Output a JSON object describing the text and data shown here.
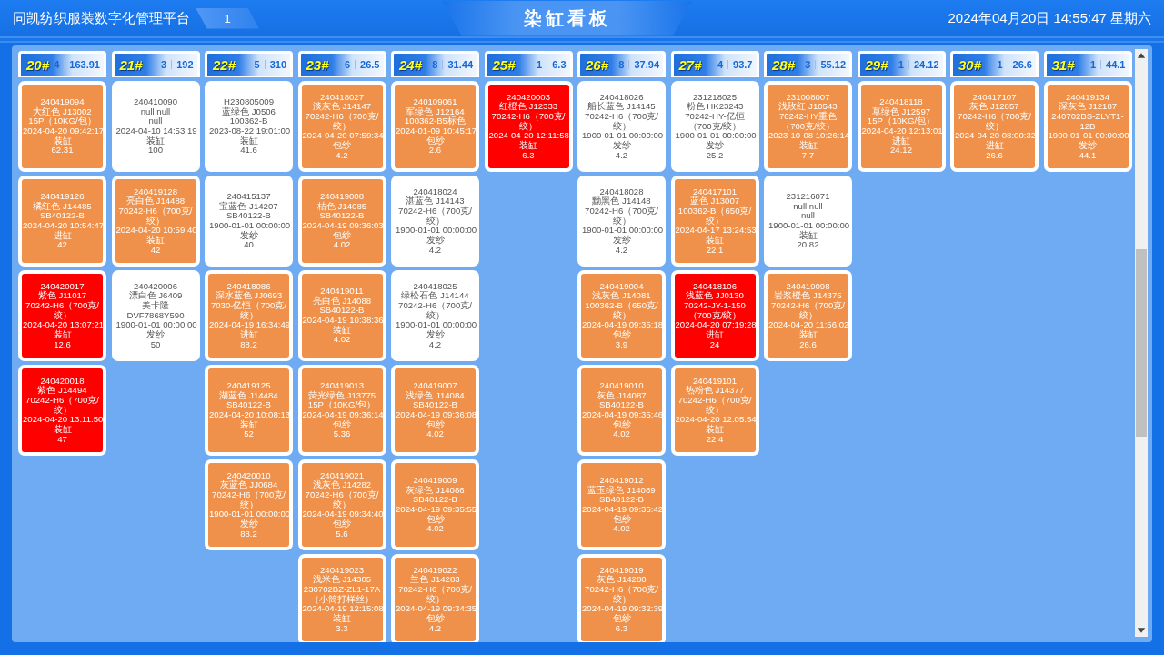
{
  "header": {
    "platform": "同凯纺织服装数字化管理平台",
    "tab": "1",
    "title": "染缸看板",
    "datetime": "2024年04月20日 14:55:47 星期六"
  },
  "columns": [
    {
      "tank": "20#",
      "count": "4",
      "weight": "163.91",
      "batches": [
        {
          "batch": "240419094",
          "shade": "大红色 J13002",
          "spec": "15P（10KG/包）",
          "time": "2024-04-20 09:42:17",
          "process": "装缸",
          "weight": "62.31",
          "loaded": true,
          "overdue": false
        },
        {
          "batch": "240419126",
          "shade": "橘红色 J14485",
          "spec": "SB40122-B",
          "time": "2024-04-20 10:54:47",
          "process": "进缸",
          "weight": "42",
          "loaded": true,
          "overdue": false
        },
        {
          "batch": "240420017",
          "shade": "紫色 J11017",
          "spec": "70242-H6（700克/绞）",
          "time": "2024-04-20 13:07:21",
          "process": "装缸",
          "weight": "12.6",
          "loaded": true,
          "overdue": true
        },
        {
          "batch": "240420018",
          "shade": "紫色 J14494",
          "spec": "70242-H6（700克/绞）",
          "time": "2024-04-20 13:11:50",
          "process": "装缸",
          "weight": "47",
          "loaded": true,
          "overdue": true
        }
      ]
    },
    {
      "tank": "21#",
      "count": "3",
      "weight": "192",
      "batches": [
        {
          "batch": "240410090",
          "shade": "null null",
          "spec": "null",
          "time": "2024-04-10 14:53:19",
          "process": "装缸",
          "weight": "100",
          "loaded": false,
          "overdue": false
        },
        {
          "batch": "240419128",
          "shade": "亮白色 J14488",
          "spec": "70242-H6（700克/绞）",
          "time": "2024-04-20 10:59:40",
          "process": "装缸",
          "weight": "42",
          "loaded": true,
          "overdue": false
        },
        {
          "batch": "240420006",
          "shade": "漂白色 J6409",
          "spec": "美卡隆DVF7868Y590",
          "time": "1900-01-01 00:00:00",
          "process": "发纱",
          "weight": "50",
          "loaded": false,
          "overdue": false
        }
      ]
    },
    {
      "tank": "22#",
      "count": "5",
      "weight": "310",
      "batches": [
        {
          "batch": "H230805009",
          "shade": "蓝绿色 J0506",
          "spec": "100362-B",
          "time": "2023-08-22 19:01:00",
          "process": "装缸",
          "weight": "41.6",
          "loaded": false,
          "overdue": false
        },
        {
          "batch": "240415137",
          "shade": "宝蓝色 J14207",
          "spec": "SB40122-B",
          "time": "1900-01-01 00:00:00",
          "process": "发纱",
          "weight": "40",
          "loaded": false,
          "overdue": false
        },
        {
          "batch": "240418086",
          "shade": "深水蓝色 JJ0693",
          "spec": "7030-亿恒（700克/绞）",
          "time": "2024-04-19 16:34:49",
          "process": "进缸",
          "weight": "88.2",
          "loaded": true,
          "overdue": false
        },
        {
          "batch": "240419125",
          "shade": "湖蓝色 J14484",
          "spec": "SB40122-B",
          "time": "2024-04-20 10:08:13",
          "process": "装缸",
          "weight": "52",
          "loaded": true,
          "overdue": false
        },
        {
          "batch": "240420010",
          "shade": "灰蓝色 JJ0684",
          "spec": "70242-H6（700克/绞）",
          "time": "1900-01-01 00:00:00",
          "process": "发纱",
          "weight": "88.2",
          "loaded": true,
          "overdue": false
        }
      ]
    },
    {
      "tank": "23#",
      "count": "6",
      "weight": "26.5",
      "batches": [
        {
          "batch": "240418027",
          "shade": "淡灰色 J14147",
          "spec": "70242-H6（700克/绞）",
          "time": "2024-04-20 07:59:34",
          "process": "包纱",
          "weight": "4.2",
          "loaded": true,
          "overdue": false
        },
        {
          "batch": "240419008",
          "shade": "桔色 J14085",
          "spec": "SB40122-B",
          "time": "2024-04-19 09:36:03",
          "process": "包纱",
          "weight": "4.02",
          "loaded": true,
          "overdue": false
        },
        {
          "batch": "240419011",
          "shade": "亮白色 J14088",
          "spec": "SB40122-B",
          "time": "2024-04-19 10:38:36",
          "process": "装缸",
          "weight": "4.02",
          "loaded": true,
          "overdue": false
        },
        {
          "batch": "240419013",
          "shade": "荧光绿色 J13775",
          "spec": "15P（10KG/包）",
          "time": "2024-04-19 09:36:14",
          "process": "包纱",
          "weight": "5.36",
          "loaded": true,
          "overdue": false
        },
        {
          "batch": "240419021",
          "shade": "浅灰色 J14282",
          "spec": "70242-H6（700克/绞）",
          "time": "2024-04-19 09:34:40",
          "process": "包纱",
          "weight": "5.6",
          "loaded": true,
          "overdue": false
        },
        {
          "batch": "240419023",
          "shade": "浅米色 J14305",
          "spec": "230702BZ-ZL1-17A（小筒打样丝）",
          "time": "2024-04-19 12:15:08",
          "process": "装缸",
          "weight": "3.3",
          "loaded": true,
          "overdue": false
        }
      ]
    },
    {
      "tank": "24#",
      "count": "8",
      "weight": "31.44",
      "batches": [
        {
          "batch": "240109061",
          "shade": "军绿色 J12164",
          "spec": "100362-B5标色",
          "time": "2024-01-09 10:45:17",
          "process": "包纱",
          "weight": "2.6",
          "loaded": true,
          "overdue": false
        },
        {
          "batch": "240418024",
          "shade": "湛蓝色 J14143",
          "spec": "70242-H6（700克/绞）",
          "time": "1900-01-01 00:00:00",
          "process": "发纱",
          "weight": "4.2",
          "loaded": false,
          "overdue": false
        },
        {
          "batch": "240418025",
          "shade": "绿松石色 J14144",
          "spec": "70242-H6（700克/绞）",
          "time": "1900-01-01 00:00:00",
          "process": "发纱",
          "weight": "4.2",
          "loaded": false,
          "overdue": false
        },
        {
          "batch": "240419007",
          "shade": "浅绿色 J14084",
          "spec": "SB40122-B",
          "time": "2024-04-19 09:36:08",
          "process": "包纱",
          "weight": "4.02",
          "loaded": true,
          "overdue": false
        },
        {
          "batch": "240419009",
          "shade": "灰绿色 J14086",
          "spec": "SB40122-B",
          "time": "2024-04-19 09:35:55",
          "process": "包纱",
          "weight": "4.02",
          "loaded": true,
          "overdue": false
        },
        {
          "batch": "240419022",
          "shade": "兰色 J14283",
          "spec": "70242-H6（700克/绞）",
          "time": "2024-04-19 09:34:35",
          "process": "包纱",
          "weight": "4.2",
          "loaded": true,
          "overdue": false
        }
      ]
    },
    {
      "tank": "25#",
      "count": "1",
      "weight": "6.3",
      "batches": [
        {
          "batch": "240420003",
          "shade": "红橙色 J12333",
          "spec": "70242-H6（700克/绞）",
          "time": "2024-04-20 12:11:58",
          "process": "装缸",
          "weight": "6.3",
          "loaded": true,
          "overdue": true
        }
      ]
    },
    {
      "tank": "26#",
      "count": "8",
      "weight": "37.94",
      "batches": [
        {
          "batch": "240418026",
          "shade": "船长蓝色 J14145",
          "spec": "70242-H6（700克/绞）",
          "time": "1900-01-01 00:00:00",
          "process": "发纱",
          "weight": "4.2",
          "loaded": false,
          "overdue": false
        },
        {
          "batch": "240418028",
          "shade": "黝黑色 J14148",
          "spec": "70242-H6（700克/绞）",
          "time": "1900-01-01 00:00:00",
          "process": "发纱",
          "weight": "4.2",
          "loaded": false,
          "overdue": false
        },
        {
          "batch": "240419004",
          "shade": "浅灰色 J14081",
          "spec": "100362-B（650克/绞）",
          "time": "2024-04-19 09:35:18",
          "process": "包纱",
          "weight": "3.9",
          "loaded": true,
          "overdue": false
        },
        {
          "batch": "240419010",
          "shade": "灰色 J14087",
          "spec": "SB40122-B",
          "time": "2024-04-19 09:35:46",
          "process": "包纱",
          "weight": "4.02",
          "loaded": true,
          "overdue": false
        },
        {
          "batch": "240419012",
          "shade": "蓝玉绿色 J14089",
          "spec": "SB40122-B",
          "time": "2024-04-19 09:35:42",
          "process": "包纱",
          "weight": "4.02",
          "loaded": true,
          "overdue": false
        },
        {
          "batch": "240419019",
          "shade": "灰色 J14280",
          "spec": "70242-H6（700克/绞）",
          "time": "2024-04-19 09:32:39",
          "process": "包纱",
          "weight": "6.3",
          "loaded": true,
          "overdue": false
        }
      ]
    },
    {
      "tank": "27#",
      "count": "4",
      "weight": "93.7",
      "batches": [
        {
          "batch": "231218025",
          "shade": "粉色 HK23243",
          "spec": "70242-HY-亿恒（700克/绞）",
          "time": "1900-01-01 00:00:00",
          "process": "发纱",
          "weight": "25.2",
          "loaded": false,
          "overdue": false
        },
        {
          "batch": "240417101",
          "shade": "蓝色 J13007",
          "spec": "100362-B（650克/绞）",
          "time": "2024-04-17 13:24:53",
          "process": "装缸",
          "weight": "22.1",
          "loaded": true,
          "overdue": false
        },
        {
          "batch": "240418106",
          "shade": "浅蓝色 JJ0130",
          "spec": "70242-JY-1-150（700克/绞）",
          "time": "2024-04-20 07:19:28",
          "process": "进缸",
          "weight": "24",
          "loaded": true,
          "overdue": true
        },
        {
          "batch": "240419101",
          "shade": "热粉色 J14377",
          "spec": "70242-H6（700克/绞）",
          "time": "2024-04-20 12:05:54",
          "process": "装缸",
          "weight": "22.4",
          "loaded": true,
          "overdue": false
        }
      ]
    },
    {
      "tank": "28#",
      "count": "3",
      "weight": "55.12",
      "batches": [
        {
          "batch": "231008007",
          "shade": "浅玫红 J10543",
          "spec": "70242-HY重色（700克/绞）",
          "time": "2023-10-08 10:26:14",
          "process": "装缸",
          "weight": "7.7",
          "loaded": true,
          "overdue": false
        },
        {
          "batch": "231216071",
          "shade": "null null",
          "spec": "null",
          "time": "1900-01-01 00:00:00",
          "process": "装缸",
          "weight": "20.82",
          "loaded": false,
          "overdue": false
        },
        {
          "batch": "240419098",
          "shade": "岩浆橙色 J14375",
          "spec": "70242-H6（700克/绞）",
          "time": "2024-04-20 11:56:02",
          "process": "装缸",
          "weight": "26.6",
          "loaded": true,
          "overdue": false
        }
      ]
    },
    {
      "tank": "29#",
      "count": "1",
      "weight": "24.12",
      "batches": [
        {
          "batch": "240418118",
          "shade": "草绿色 J12597",
          "spec": "15P（10KG/包）",
          "time": "2024-04-20 12:13:01",
          "process": "进缸",
          "weight": "24.12",
          "loaded": true,
          "overdue": false
        }
      ]
    },
    {
      "tank": "30#",
      "count": "1",
      "weight": "26.6",
      "batches": [
        {
          "batch": "240417107",
          "shade": "灰色 J12857",
          "spec": "70242-H6（700克/绞）",
          "time": "2024-04-20 08:00:32",
          "process": "进缸",
          "weight": "26.6",
          "loaded": true,
          "overdue": false
        }
      ]
    },
    {
      "tank": "31#",
      "count": "1",
      "weight": "44.1",
      "batches": [
        {
          "batch": "240419134",
          "shade": "深灰色 J12187",
          "spec": "240702BS-ZLYT1-12B",
          "time": "1900-01-01 00:00:00",
          "process": "发纱",
          "weight": "44.1",
          "loaded": true,
          "overdue": false
        }
      ]
    }
  ]
}
